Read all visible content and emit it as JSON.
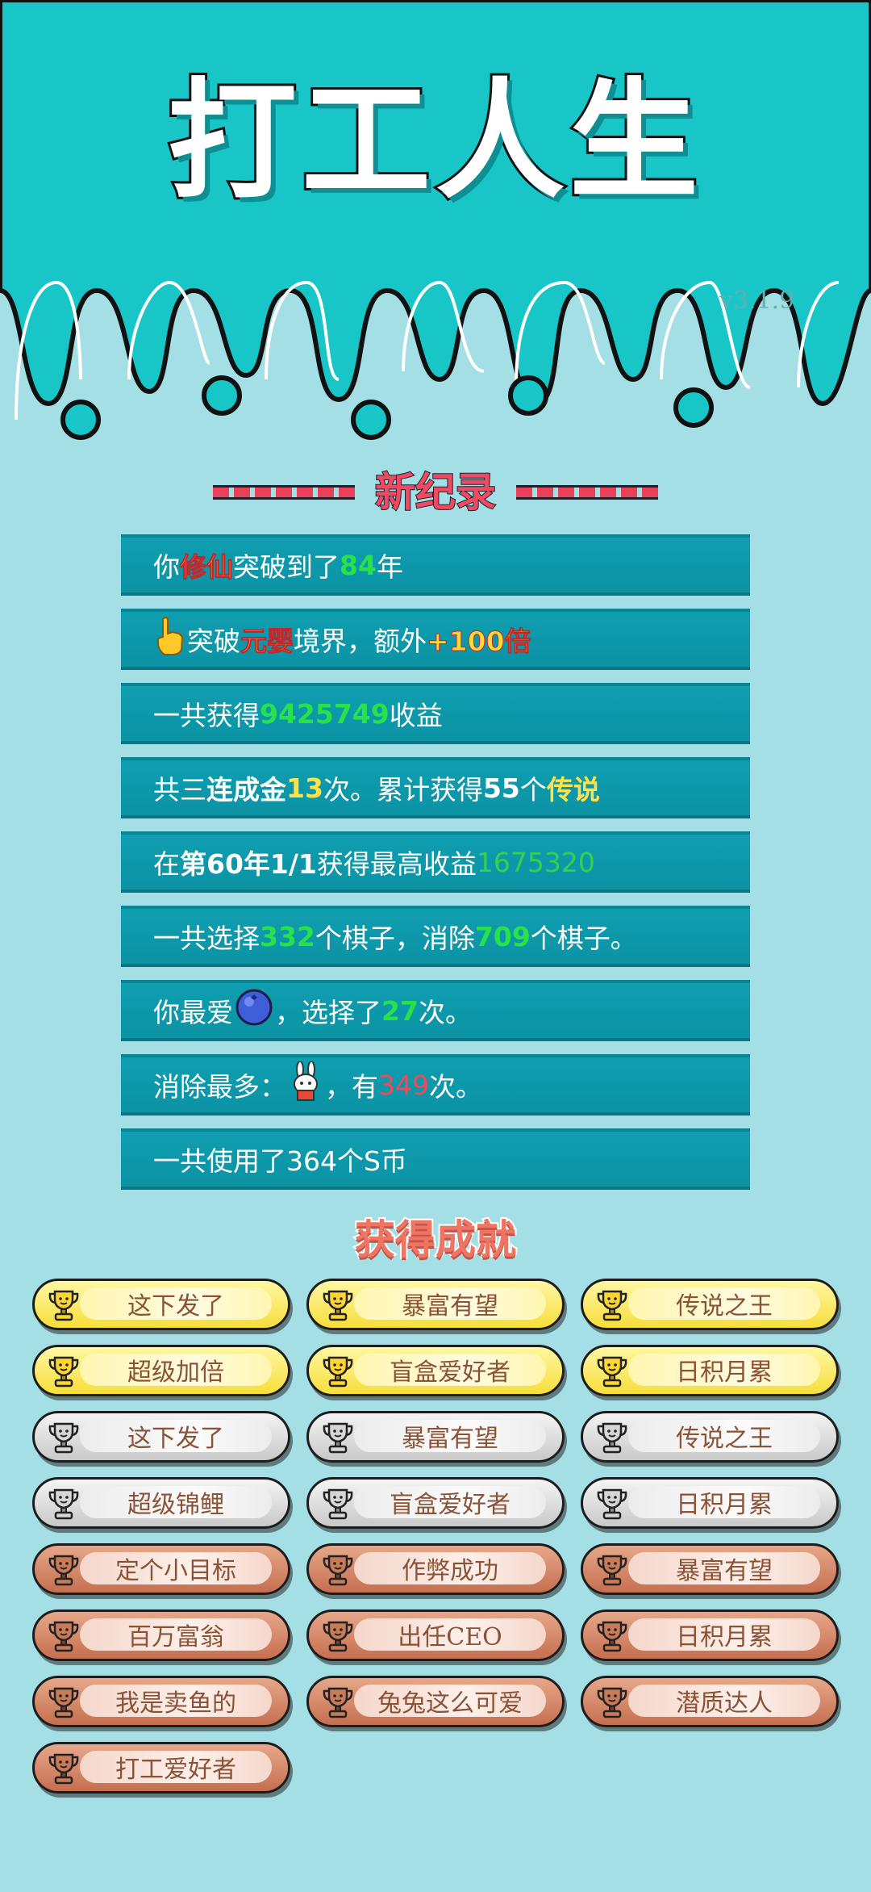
{
  "header": {
    "title": "打工人生",
    "version": "v3.1.9"
  },
  "records": {
    "title": "新纪录",
    "rows": [
      {
        "parts": [
          {
            "t": "你",
            "c": "s"
          },
          {
            "t": "修仙",
            "c": "hl-y"
          },
          {
            "t": "突破到了",
            "c": "s"
          },
          {
            "t": "84",
            "c": "hl-g"
          },
          {
            "t": "年",
            "c": "s"
          }
        ]
      },
      {
        "icon": "pointing-hand-icon",
        "parts": [
          {
            "t": "突破",
            "c": "s"
          },
          {
            "t": "元婴",
            "c": "hl-y"
          },
          {
            "t": "境界，额外",
            "c": "s"
          },
          {
            "t": "+100倍",
            "c": "hl-y"
          }
        ]
      },
      {
        "parts": [
          {
            "t": "一共获得",
            "c": "s"
          },
          {
            "t": "9425749",
            "c": "hl-g"
          },
          {
            "t": "收益",
            "c": "s"
          }
        ]
      },
      {
        "parts": [
          {
            "t": "共三",
            "c": "s"
          },
          {
            "t": "连成金",
            "c": "hl-w"
          },
          {
            "t": "13",
            "c": "hl-yb"
          },
          {
            "t": "次。累计获得",
            "c": "s"
          },
          {
            "t": "55",
            "c": "hl-w"
          },
          {
            "t": "个",
            "c": "s"
          },
          {
            "t": "传说",
            "c": "hl-yb"
          }
        ]
      },
      {
        "parts": [
          {
            "t": "在 ",
            "c": "s"
          },
          {
            "t": "第60年1/1",
            "c": "hl-w"
          },
          {
            "t": " 获得最高收益",
            "c": "s"
          },
          {
            "t": "1675320",
            "c": "hl-gl"
          }
        ]
      },
      {
        "parts": [
          {
            "t": "一共选择",
            "c": "s"
          },
          {
            "t": "332",
            "c": "hl-g"
          },
          {
            "t": "个棋子，消除",
            "c": "s"
          },
          {
            "t": "709",
            "c": "hl-g"
          },
          {
            "t": "个棋子。",
            "c": "s"
          }
        ]
      },
      {
        "parts": [
          {
            "t": "你最爱",
            "c": "s"
          },
          {
            "icon": "blueberry-icon"
          },
          {
            "t": "，选择了",
            "c": "s"
          },
          {
            "t": "27",
            "c": "hl-g"
          },
          {
            "t": "次。",
            "c": "s"
          }
        ]
      },
      {
        "parts": [
          {
            "t": "消除最多：",
            "c": "s"
          },
          {
            "icon": "rabbit-icon"
          },
          {
            "t": "，有",
            "c": "s"
          },
          {
            "t": "349",
            "c": "hl-r"
          },
          {
            "t": "次。",
            "c": "s"
          }
        ]
      },
      {
        "parts": [
          {
            "t": "一共使用了364个S币",
            "c": "s"
          }
        ]
      }
    ]
  },
  "achievements": {
    "title": "获得成就",
    "items": [
      {
        "label": "这下发了",
        "tier": "gold"
      },
      {
        "label": "暴富有望",
        "tier": "gold"
      },
      {
        "label": "传说之王",
        "tier": "gold"
      },
      {
        "label": "超级加倍",
        "tier": "gold"
      },
      {
        "label": "盲盒爱好者",
        "tier": "gold"
      },
      {
        "label": "日积月累",
        "tier": "gold"
      },
      {
        "label": "这下发了",
        "tier": "silver"
      },
      {
        "label": "暴富有望",
        "tier": "silver"
      },
      {
        "label": "传说之王",
        "tier": "silver"
      },
      {
        "label": "超级锦鲤",
        "tier": "silver"
      },
      {
        "label": "盲盒爱好者",
        "tier": "silver"
      },
      {
        "label": "日积月累",
        "tier": "silver"
      },
      {
        "label": "定个小目标",
        "tier": "bronze"
      },
      {
        "label": "作弊成功",
        "tier": "bronze"
      },
      {
        "label": "暴富有望",
        "tier": "bronze"
      },
      {
        "label": "百万富翁",
        "tier": "bronze"
      },
      {
        "label": "出任CEO",
        "tier": "bronze"
      },
      {
        "label": "日积月累",
        "tier": "bronze"
      },
      {
        "label": "我是卖鱼的",
        "tier": "bronze"
      },
      {
        "label": "兔兔这么可爱",
        "tier": "bronze"
      },
      {
        "label": "潜质达人",
        "tier": "bronze"
      },
      {
        "label": "打工爱好者",
        "tier": "bronze"
      }
    ]
  },
  "colors": {
    "header_bg": "#18c6c8",
    "page_bg": "#a4dfe6",
    "card_bg": "#0e9eb0",
    "highlight_green": "#29e24a",
    "highlight_yellow": "#ffd93a",
    "highlight_red": "#ef4a5c"
  }
}
